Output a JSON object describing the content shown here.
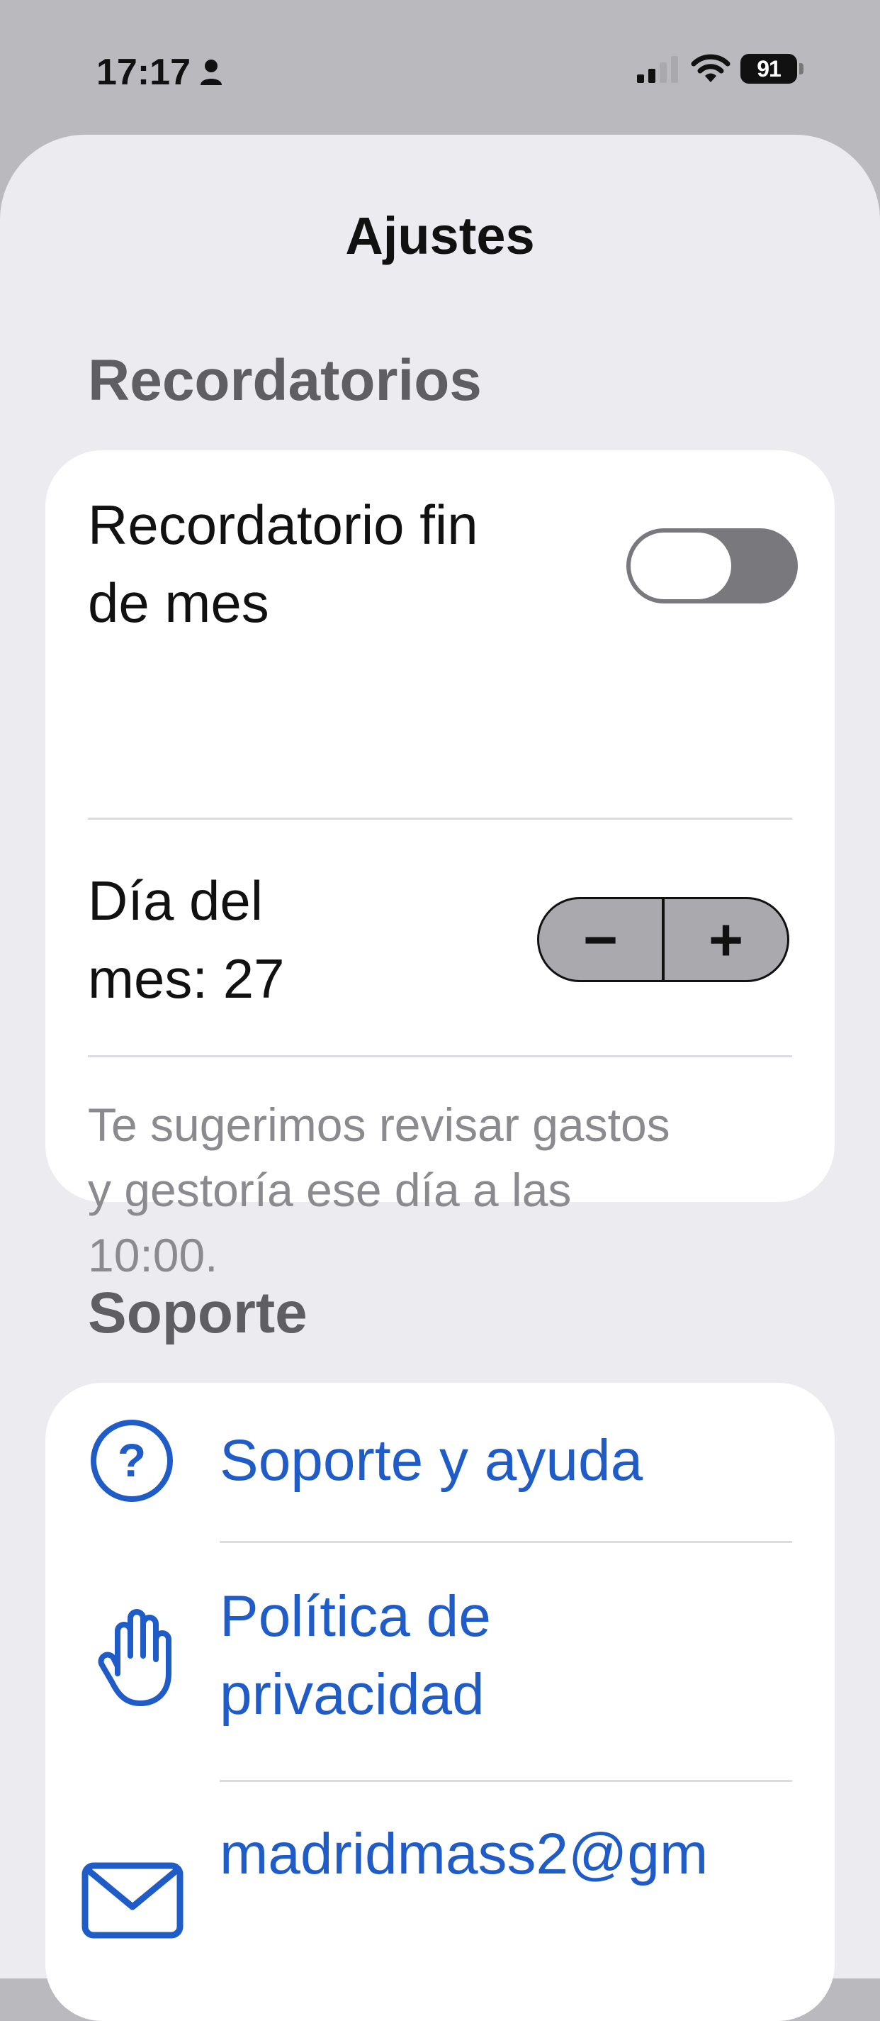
{
  "status_bar": {
    "time": "17:17",
    "battery_level": "91"
  },
  "header": {
    "title": "Ajustes"
  },
  "reminders": {
    "section_title": "Recordatorios",
    "end_of_month_label_line1": "Recordatorio fin",
    "end_of_month_label_line2": "de mes",
    "end_of_month_enabled": false,
    "day_label_line1": "Día del",
    "day_label_line2": "mes: 27",
    "stepper_minus": "−",
    "stepper_plus": "+",
    "hint_line1": "Te sugerimos revisar gastos",
    "hint_line2": "y gestoría ese día a las",
    "hint_line3": "10:00."
  },
  "support": {
    "section_title": "Soporte",
    "items": [
      {
        "label": "Soporte y ayuda",
        "icon": "question-circle-icon"
      },
      {
        "label_line1": "Política de",
        "label_line2": "privacidad",
        "icon": "hand-raised-icon"
      },
      {
        "label": "madridmass2@gm",
        "icon": "envelope-icon"
      }
    ]
  },
  "colors": {
    "accent": "#1f5cc8",
    "background": "#ebebf0",
    "section_header": "#5e5e63"
  }
}
